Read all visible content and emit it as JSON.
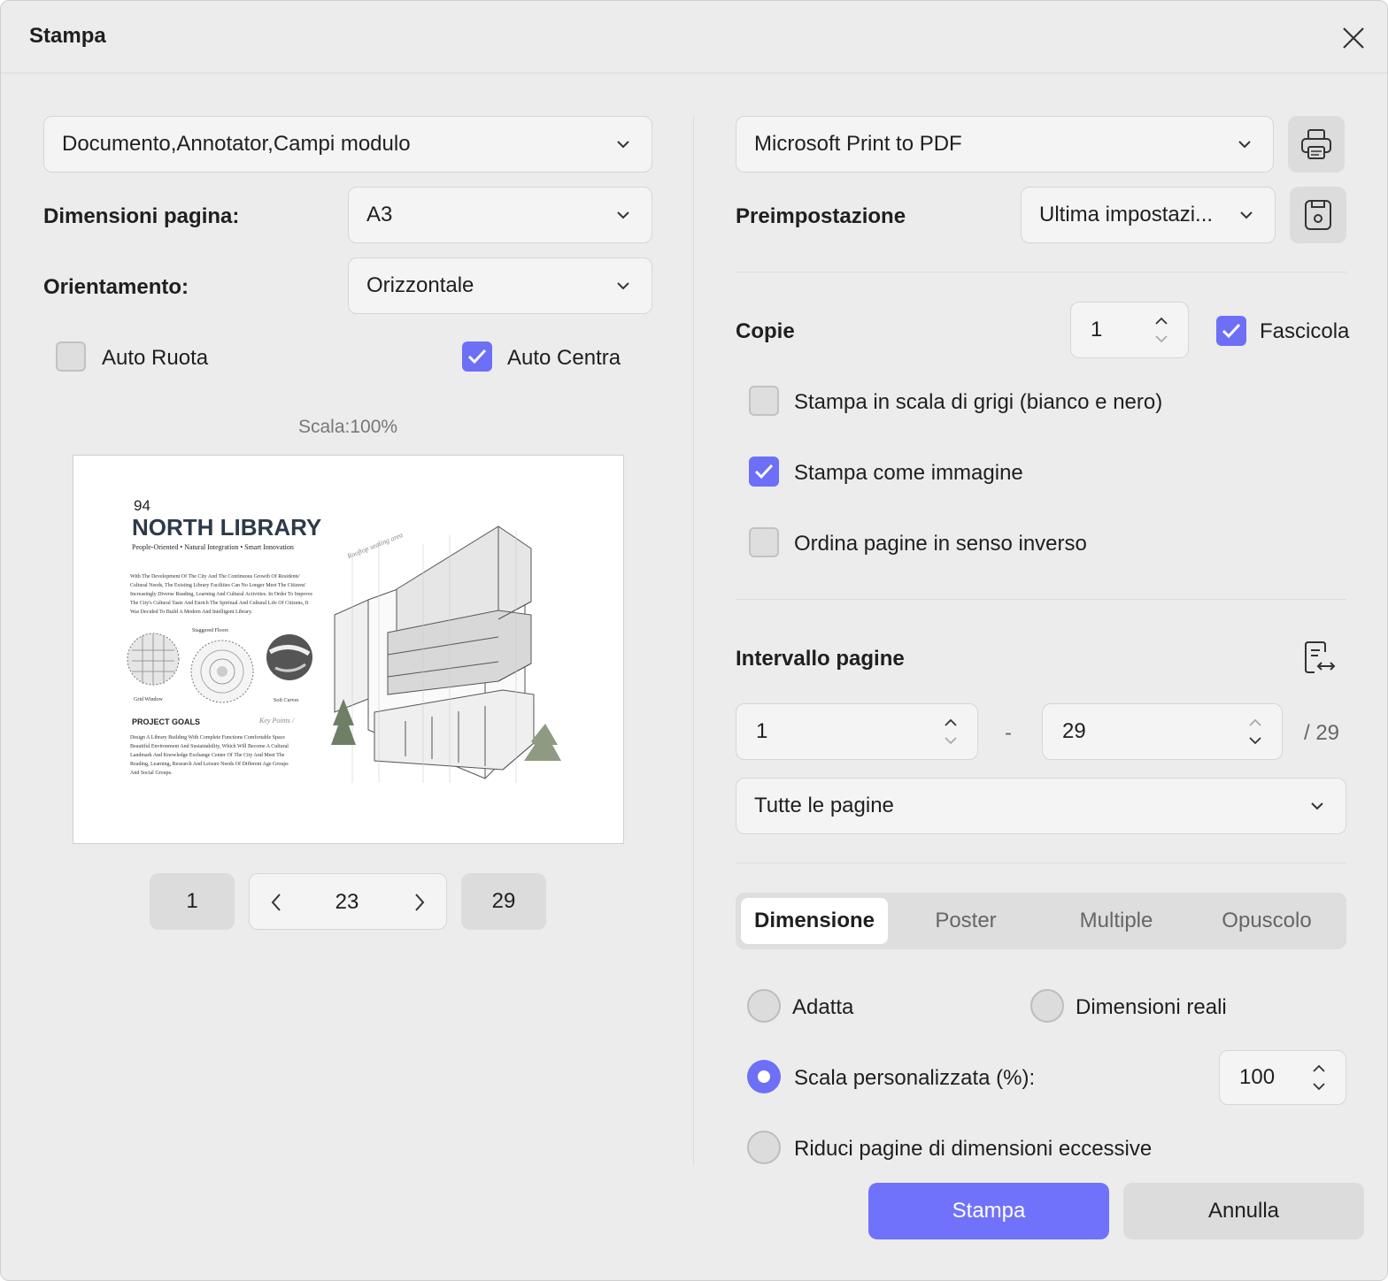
{
  "dialog": {
    "title": "Stampa"
  },
  "left": {
    "content_select": "Documento,Annotator,Campi modulo",
    "page_size": {
      "label": "Dimensioni pagina:",
      "value": "A3"
    },
    "orientation": {
      "label": "Orientamento:",
      "value": "Orizzontale"
    },
    "auto_rotate": {
      "label": "Auto Ruota",
      "checked": false
    },
    "auto_center": {
      "label": "Auto Centra",
      "checked": true
    },
    "scale_text": "Scala:100%",
    "preview": {
      "page_number": "94",
      "heading": "NORTH LIBRARY",
      "tagline": "People-Oriented • Natural Integration • Smart Innovation",
      "intro_lines": [
        "With The Development Of The City And The Continuous Growth Of Residents'",
        "Cultural Needs, The Existing Library Facilities Can No Longer Meet The Citizens'",
        "Increasingly Diverse Reading, Learning And Cultural Activities. In Order To Improve",
        "The City's Cultural Taste And Enrich The Spiritual And Cultural Life Of Citizens, It",
        "Was Decided To Build A Modern And Intelligent Library."
      ],
      "callout_staggered": "Staggered Floors",
      "callout_grid": "Grid Window",
      "callout_soft": "Soft Curves",
      "goals_title": "PROJECT GOALS",
      "key_points": "Key Points /",
      "rooftop_note": "Rooftop seating area",
      "goals_lines": [
        "Design A Library Building With Complete Functions Comfortable Space",
        "Beautiful Environment And Sustainability, Which Will Become A Cultural",
        "Landmark And Knowledge Exchange Center Of The City And Meet The",
        "Reading, Learning, Research And Leisure Needs Of Different Age Groups",
        "And Social Groups."
      ]
    },
    "pager": {
      "first": "1",
      "current": "23",
      "last": "29"
    }
  },
  "right": {
    "printer": "Microsoft Print to PDF",
    "preset": {
      "label": "Preimpostazione",
      "value": "Ultima impostazi..."
    },
    "copies": {
      "label": "Copie",
      "value": "1"
    },
    "collate": {
      "label": "Fascicola",
      "checked": true
    },
    "grayscale": {
      "label": "Stampa in scala di grigi (bianco e nero)",
      "checked": false
    },
    "as_image": {
      "label": "Stampa come immagine",
      "checked": true
    },
    "reverse": {
      "label": "Ordina pagine in senso inverso",
      "checked": false
    },
    "range": {
      "label": "Intervallo pagine",
      "from": "1",
      "separator": "-",
      "to": "29",
      "total": "/ 29",
      "subset": "Tutte le pagine"
    },
    "tabs": [
      "Dimensione",
      "Poster",
      "Multiple",
      "Opuscolo"
    ],
    "active_tab": "Dimensione",
    "sizing": {
      "fit": "Adatta",
      "actual": "Dimensioni reali",
      "custom": "Scala personalizzata (%):",
      "custom_value": "100",
      "shrink": "Riduci pagine di dimensioni eccessive",
      "selected": "custom"
    }
  },
  "footer": {
    "print": "Stampa",
    "cancel": "Annulla"
  },
  "colors": {
    "accent": "#6e6ff7",
    "background": "#ececec",
    "field": "#f4f4f4"
  }
}
